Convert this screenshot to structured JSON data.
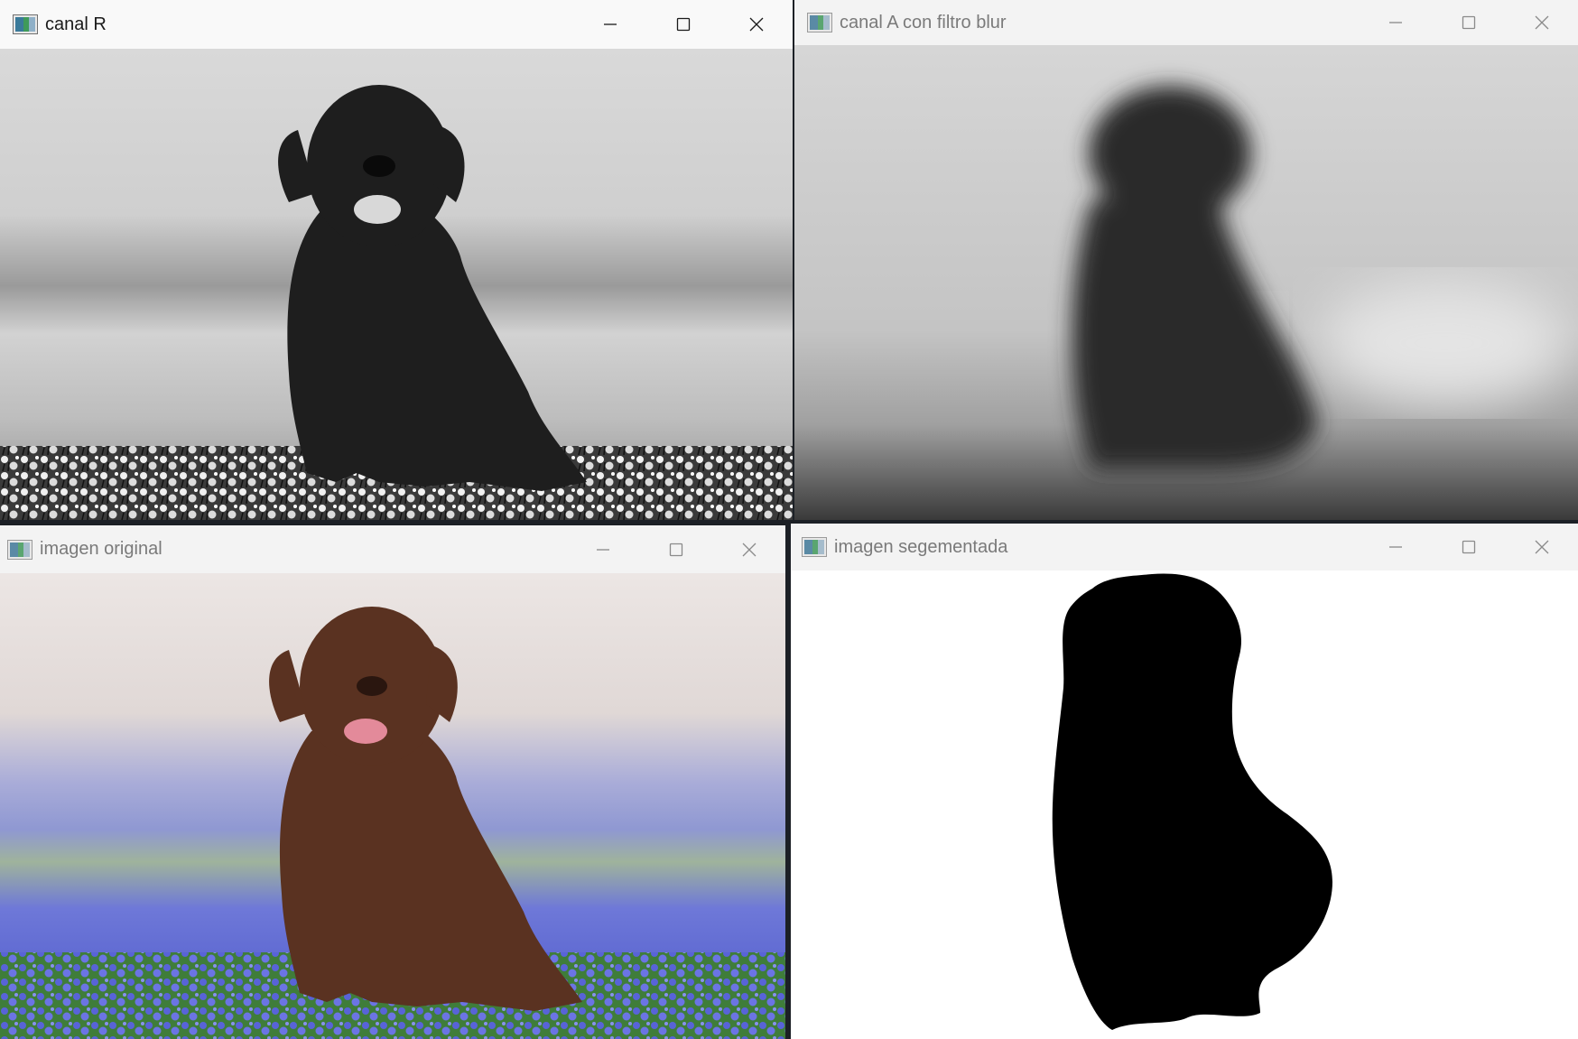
{
  "windows": [
    {
      "id": "canal-r",
      "title": "canal R",
      "active": true
    },
    {
      "id": "canal-a",
      "title": "canal A con filtro blur",
      "active": false
    },
    {
      "id": "original",
      "title": "imagen original",
      "active": false
    },
    {
      "id": "segmentada",
      "title": "imagen segementada",
      "active": false
    }
  ],
  "icons": {
    "app": "opencv-window-icon",
    "minimize": "minimize-icon",
    "maximize": "maximize-icon",
    "close": "close-icon"
  },
  "colors": {
    "titlebar_active": "#f9f9f9",
    "titlebar_inactive": "#f3f3f3",
    "flowers": "#5863d8",
    "dog_brown": "#5a3221"
  }
}
